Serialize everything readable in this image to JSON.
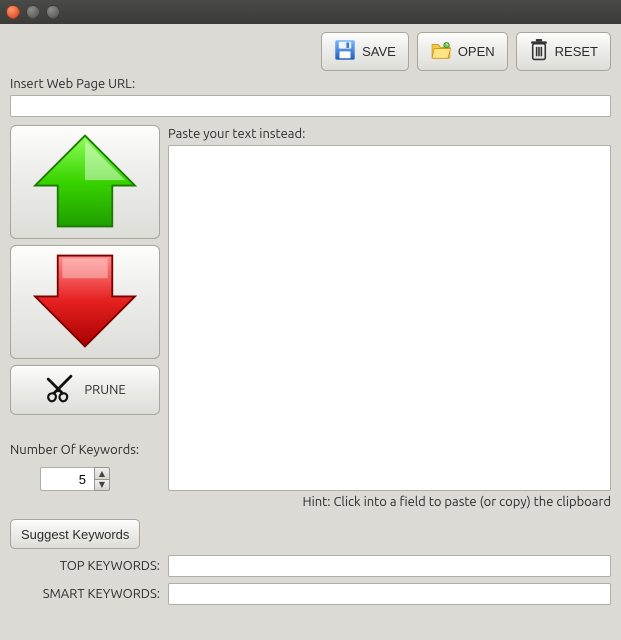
{
  "toolbar": {
    "save_label": "SAVE",
    "open_label": "OPEN",
    "reset_label": "RESET"
  },
  "url_section": {
    "label": "Insert Web Page URL:",
    "value": ""
  },
  "text_section": {
    "label": "Paste your text instead:",
    "value": ""
  },
  "prune_label": "PRUNE",
  "keywords_count": {
    "label": "Number Of Keywords:",
    "value": "5"
  },
  "suggest_button": "Suggest Keywords",
  "hint": "Hint: Click into a field to paste (or copy) the clipboard",
  "top_keywords": {
    "label": "TOP KEYWORDS:",
    "value": ""
  },
  "smart_keywords": {
    "label": "SMART KEYWORDS:",
    "value": ""
  },
  "icons": {
    "up": "arrow-up-icon",
    "down": "arrow-down-icon",
    "save": "floppy-disk-icon",
    "open": "folder-open-icon",
    "reset": "trash-icon",
    "prune": "shears-icon"
  }
}
